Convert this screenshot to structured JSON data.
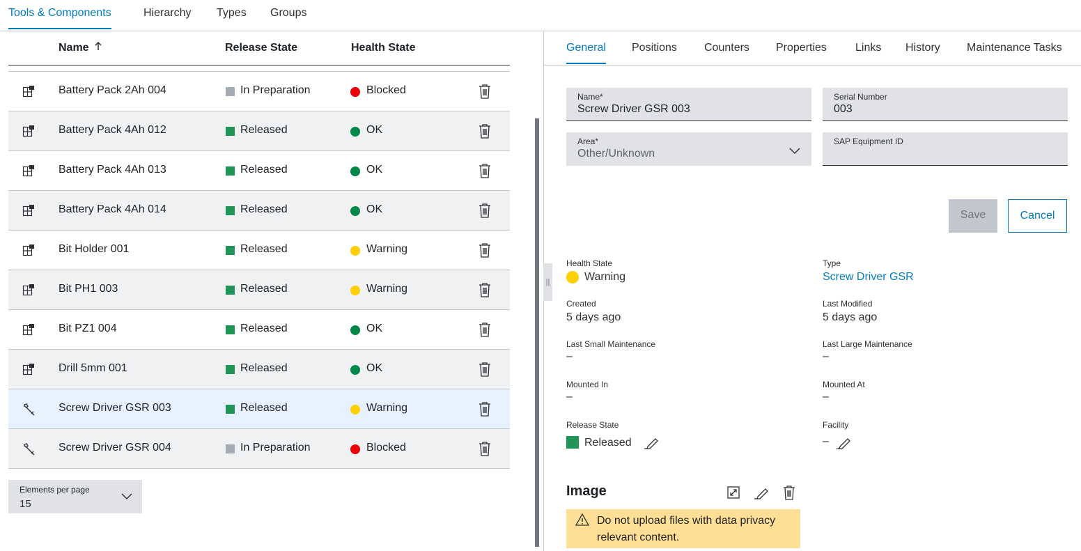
{
  "top_tabs": [
    {
      "label": "Tools & Components",
      "active": true
    },
    {
      "label": "Hierarchy"
    },
    {
      "label": "Types"
    },
    {
      "label": "Groups"
    }
  ],
  "table": {
    "headers": {
      "name": "Name",
      "release": "Release State",
      "health": "Health State"
    },
    "rows": [
      {
        "name": "Battery Pack 2Ah 004",
        "release": "In Preparation",
        "health": "Blocked",
        "icon": "component-icon"
      },
      {
        "name": "Battery Pack 4Ah 012",
        "release": "Released",
        "health": "OK",
        "icon": "component-icon"
      },
      {
        "name": "Battery Pack 4Ah 013",
        "release": "Released",
        "health": "OK",
        "icon": "component-icon"
      },
      {
        "name": "Battery Pack 4Ah 014",
        "release": "Released",
        "health": "OK",
        "icon": "component-icon"
      },
      {
        "name": "Bit Holder 001",
        "release": "Released",
        "health": "Warning",
        "icon": "component-icon"
      },
      {
        "name": "Bit PH1 003",
        "release": "Released",
        "health": "Warning",
        "icon": "component-icon"
      },
      {
        "name": "Bit PZ1 004",
        "release": "Released",
        "health": "OK",
        "icon": "component-icon"
      },
      {
        "name": "Drill 5mm 001",
        "release": "Released",
        "health": "OK",
        "icon": "component-icon"
      },
      {
        "name": "Screw Driver GSR 003",
        "release": "Released",
        "health": "Warning",
        "icon": "wrench-icon",
        "selected": true
      },
      {
        "name": "Screw Driver GSR 004",
        "release": "In Preparation",
        "health": "Blocked",
        "icon": "wrench-icon"
      }
    ]
  },
  "pager": {
    "label": "Elements per page",
    "value": "15"
  },
  "detail_tabs": [
    {
      "label": "General",
      "active": true
    },
    {
      "label": "Positions"
    },
    {
      "label": "Counters"
    },
    {
      "label": "Properties"
    },
    {
      "label": "Links"
    },
    {
      "label": "History"
    },
    {
      "label": "Maintenance Tasks"
    }
  ],
  "form": {
    "name_label": "Name*",
    "name_value": "Screw Driver GSR 003",
    "serial_label": "Serial Number",
    "serial_value": "003",
    "area_label": "Area*",
    "area_value": "Other/Unknown",
    "sap_label": "SAP Equipment ID",
    "sap_value": ""
  },
  "buttons": {
    "save": "Save",
    "cancel": "Cancel"
  },
  "info": {
    "health_label": "Health State",
    "health_value": "Warning",
    "type_label": "Type",
    "type_value": "Screw Driver GSR",
    "created_label": "Created",
    "created_value": "5 days ago",
    "modified_label": "Last Modified",
    "modified_value": "5 days ago",
    "small_maint_label": "Last Small Maintenance",
    "small_maint_value": "–",
    "large_maint_label": "Last Large Maintenance",
    "large_maint_value": "–",
    "mounted_in_label": "Mounted In",
    "mounted_in_value": "–",
    "mounted_at_label": "Mounted At",
    "mounted_at_value": "–",
    "release_label": "Release State",
    "release_value": "Released",
    "facility_label": "Facility",
    "facility_value": "–"
  },
  "image_section": {
    "title": "Image",
    "warning": "Do not upload files with data privacy relevant content."
  },
  "colors": {
    "accent": "#007bc0",
    "released": "#219557",
    "in_preparation": "#a4abb3",
    "ok": "#00884a",
    "warning": "#ffcf00",
    "blocked": "#ed0007",
    "selected_row": "#e8f1ff",
    "warning_banner": "#ffdf95"
  }
}
